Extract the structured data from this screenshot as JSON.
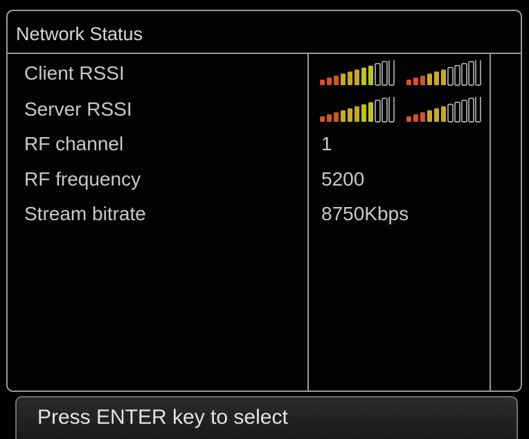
{
  "panel": {
    "title": "Network Status"
  },
  "rows": [
    {
      "label": "Client RSSI"
    },
    {
      "label": "Server RSSI"
    },
    {
      "label": "RF channel",
      "value": "1"
    },
    {
      "label": "RF frequency",
      "value": "5200"
    },
    {
      "label": "Stream bitrate",
      "value": "8750Kbps"
    }
  ],
  "meters": {
    "client": {
      "meter1_level": 8,
      "meter2_level": 6,
      "total_bars": 11
    },
    "server": {
      "meter1_level": 8,
      "meter2_level": 6,
      "total_bars": 11
    }
  },
  "colors": {
    "bar_low": "#d2542a",
    "bar_mid": "#c8a82a",
    "bar_high": "#b9c22e",
    "bar_empty": "#cfcfcf"
  },
  "footer": {
    "hint": "Press ENTER key to select"
  }
}
